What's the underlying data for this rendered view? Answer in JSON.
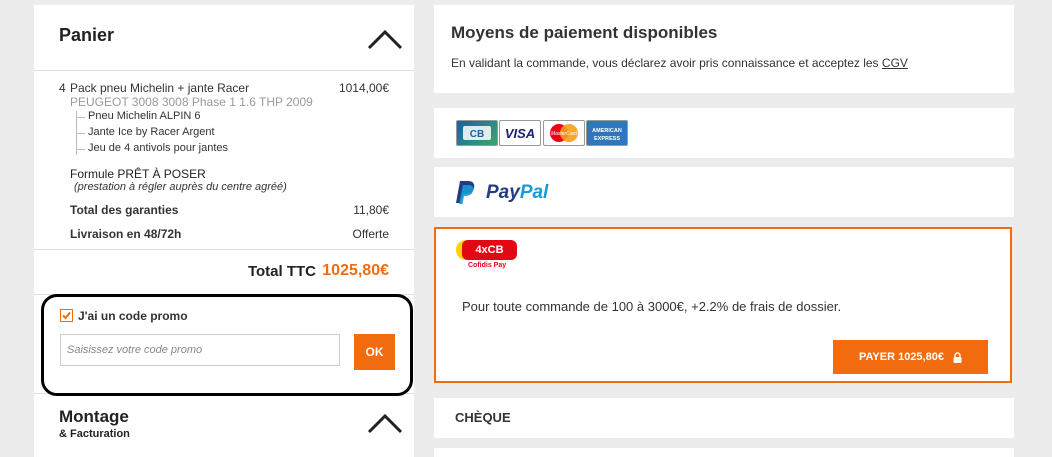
{
  "cart": {
    "title": "Panier",
    "item": {
      "qty": "4",
      "name": "Pack pneu Michelin + jante Racer",
      "price": "1014,00€",
      "vehicle": "PEUGEOT 3008 3008 Phase 1 1.6 THP 2009",
      "components": [
        "Pneu Michelin ALPIN 6",
        "Jante Ice by Racer Argent",
        "Jeu de 4 antivols pour jantes"
      ]
    },
    "formula": {
      "label": "Formule PRÊT À POSER",
      "note": "(prestation à régler auprès du centre agréé)"
    },
    "guarantees": {
      "label": "Total des garanties",
      "value": "11,80€"
    },
    "delivery": {
      "label": "Livraison en 48/72h",
      "value": "Offerte"
    },
    "total": {
      "label": "Total TTC",
      "value": "1025,80€"
    },
    "promo": {
      "checkbox_label": "J'ai un code promo",
      "checked": true,
      "placeholder": "Saisissez votre code promo",
      "value": "",
      "ok_label": "OK"
    },
    "montage": {
      "title": "Montage",
      "subtitle": "& Facturation"
    },
    "icons": {
      "collapse": "chevron-up-icon",
      "checkbox": "check-icon"
    }
  },
  "payment": {
    "title": "Moyens de paiement disponibles",
    "cgv_text": "En validant la commande, vous déclarez avoir pris connaissance et acceptez les",
    "cgv_link": "CGV",
    "cards": [
      {
        "name": "CB",
        "label": "CB"
      },
      {
        "name": "VISA",
        "label": "VISA"
      },
      {
        "name": "MasterCard",
        "label": "MasterCard"
      },
      {
        "name": "American Express",
        "label": "AMERICAN EXPRESS"
      }
    ],
    "paypal": {
      "label_a": "Pay",
      "label_b": "Pal"
    },
    "cofidis": {
      "badge": "4xCB",
      "sub": "Cofidis Pay",
      "description": "Pour toute commande de 100 à 3000€, +2.2% de frais de dossier.",
      "button": "PAYER 1025,80€"
    },
    "cheque": {
      "title": "CHÈQUE"
    }
  },
  "colors": {
    "accent": "#f26b0f",
    "background": "#ececec",
    "panel": "#ffffff",
    "cofidis_red": "#e30613",
    "paypal_dark": "#253b80",
    "paypal_light": "#179bd7"
  }
}
